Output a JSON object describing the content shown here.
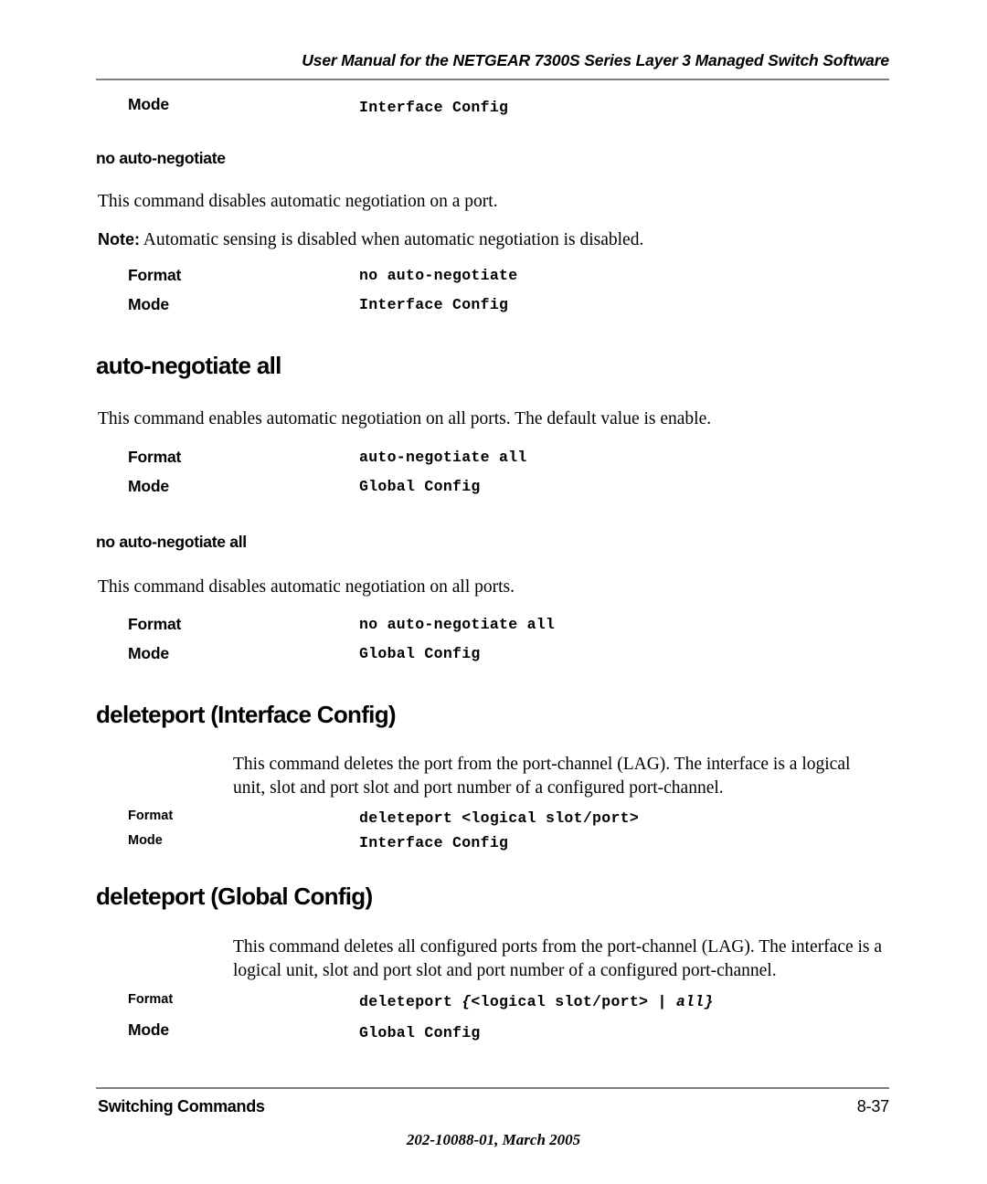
{
  "header": {
    "running_title": "User Manual for the NETGEAR 7300S Series Layer 3 Managed Switch Software"
  },
  "top_spec": {
    "mode_label": "Mode",
    "mode_value": "Interface Config"
  },
  "sections": [
    {
      "id": "no-auto-negotiate",
      "heading": "no auto-negotiate",
      "heading_level": "sub",
      "description": "This command disables automatic negotiation on a port.",
      "note_label": "Note:",
      "note_text": " Automatic sensing is disabled when automatic negotiation is disabled.",
      "format_label": "Format",
      "format_value": "no auto-negotiate",
      "mode_label": "Mode",
      "mode_value": "Interface Config"
    },
    {
      "id": "auto-negotiate-all",
      "heading": "auto-negotiate all",
      "heading_level": "h1",
      "description": "This command enables automatic negotiation on all ports. The default value is enable.",
      "format_label": "Format",
      "format_value": "auto-negotiate all",
      "mode_label": "Mode",
      "mode_value": "Global Config"
    },
    {
      "id": "no-auto-negotiate-all",
      "heading": "no auto-negotiate all",
      "heading_level": "sub",
      "description": "This command disables automatic negotiation on all ports.",
      "format_label": "Format",
      "format_value": "no auto-negotiate all",
      "mode_label": "Mode",
      "mode_value": "Global Config"
    },
    {
      "id": "deleteport-interface-config",
      "heading": "deleteport (Interface Config)",
      "heading_level": "h1",
      "description": "This command deletes the port from the port-channel (LAG). The interface is a logical unit, slot and port slot and port number of a configured port-channel.",
      "format_label": "Format",
      "format_value": "deleteport <logical slot/port>",
      "mode_label": "Mode",
      "mode_value": "Interface Config"
    },
    {
      "id": "deleteport-global-config",
      "heading": "deleteport (Global Config)",
      "heading_level": "h1",
      "description": "This command deletes all configured ports from the port-channel (LAG). The interface is a logical unit, slot and port slot and port number of a configured port-channel.",
      "format_label": "Format",
      "format_value_parts": {
        "pre": "deleteport ",
        "brace_open": "{",
        "arg": "<logical slot/port> | ",
        "italic_all": "all",
        "brace_close": "}"
      },
      "mode_label": "Mode",
      "mode_value": "Global Config"
    }
  ],
  "footer": {
    "left": "Switching Commands",
    "page_number": "8-37",
    "center": "202-10088-01, March 2005"
  }
}
